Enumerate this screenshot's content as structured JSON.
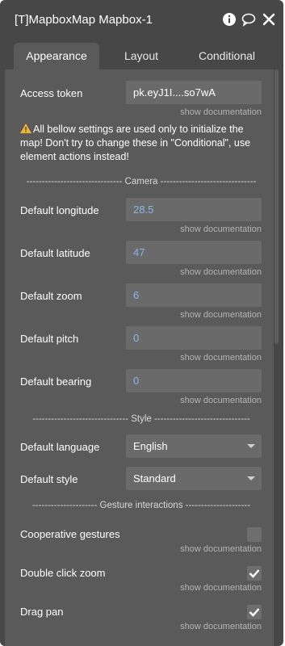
{
  "header": {
    "title": "[T]MapboxMap Mapbox-1"
  },
  "tabs": [
    {
      "label": "Appearance",
      "active": true
    },
    {
      "label": "Layout",
      "active": false
    },
    {
      "label": "Conditional",
      "active": false
    }
  ],
  "fields": {
    "access_token": {
      "label": "Access token",
      "value": "pk.eyJ1I....so7wA"
    },
    "show_documentation": "show documentation",
    "warning": "All bellow settings are used only to initialize the map! Don't try to change these in \"Conditional\", use element actions instead!",
    "camera_sep": "------------------------------- Camera -------------------------------",
    "longitude": {
      "label": "Default longitude",
      "value": "28.5"
    },
    "latitude": {
      "label": "Default latitude",
      "value": "47"
    },
    "zoom": {
      "label": "Default zoom",
      "value": "6"
    },
    "pitch": {
      "label": "Default pitch",
      "value": "0"
    },
    "bearing": {
      "label": "Default bearing",
      "value": "0"
    },
    "style_sep": "------------------------------- Style -------------------------------",
    "language": {
      "label": "Default language",
      "value": "English"
    },
    "style": {
      "label": "Default style",
      "value": "Standard"
    },
    "gesture_sep": "--------------------- Gesture interactions ---------------------",
    "cooperative": {
      "label": "Cooperative gestures",
      "checked": false
    },
    "double_click": {
      "label": "Double click zoom",
      "checked": true
    },
    "drag_pan": {
      "label": "Drag pan",
      "checked": true
    }
  },
  "colors": {
    "panel": "#474747",
    "body": "#5a5a5a",
    "field": "#6a6a6a",
    "number": "#8fb6e8",
    "warning": "#f2b233"
  }
}
